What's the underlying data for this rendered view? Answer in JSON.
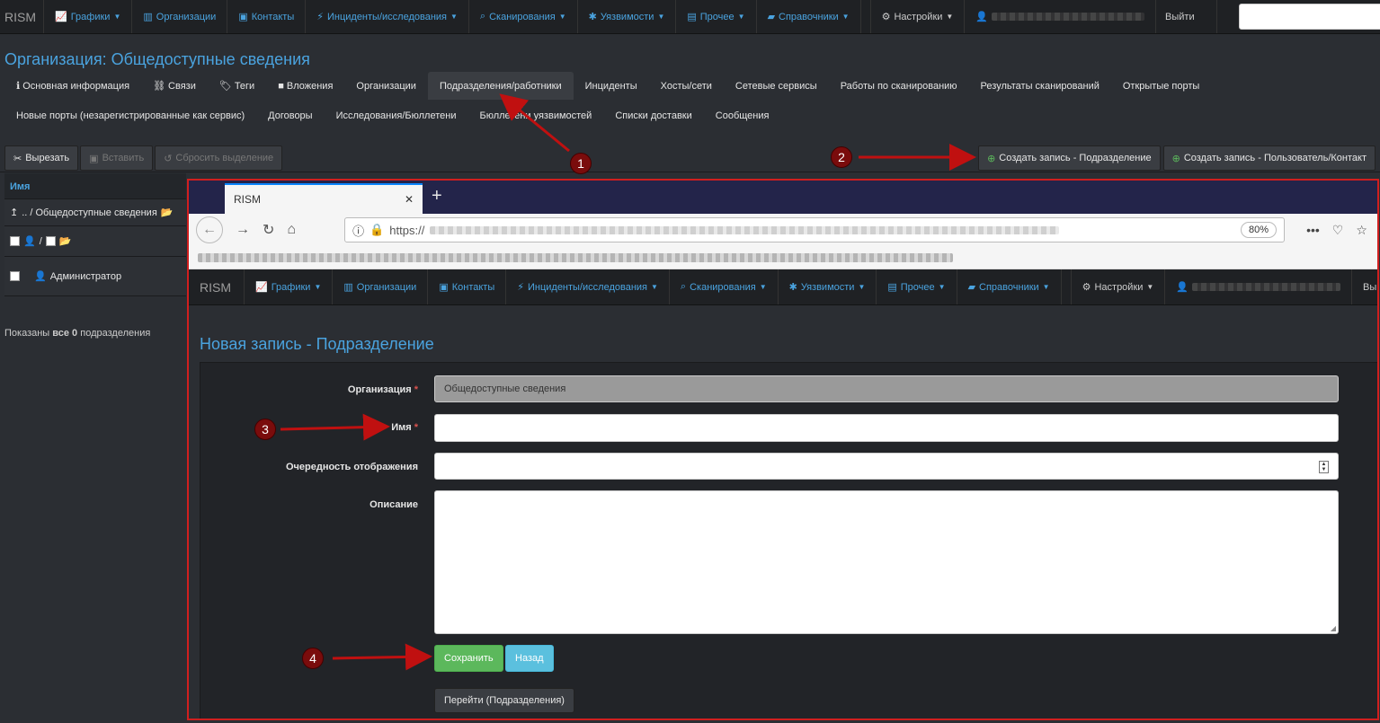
{
  "navbar": {
    "brand": "RISM",
    "items": [
      {
        "icon": "chart-icon",
        "label": "Графики"
      },
      {
        "icon": "bar-chart-icon",
        "label": "Организации"
      },
      {
        "icon": "id-card-icon",
        "label": "Контакты"
      },
      {
        "icon": "bolt-icon",
        "label": "Инциденты/исследования"
      },
      {
        "icon": "search-icon",
        "label": "Сканирования"
      },
      {
        "icon": "bug-icon",
        "label": "Уязвимости"
      },
      {
        "icon": "box-icon",
        "label": "Прочее"
      },
      {
        "icon": "book-icon",
        "label": "Справочники"
      }
    ],
    "settings": "Настройки",
    "logout": "Выйти"
  },
  "page": {
    "title": "Организация: Общедоступные сведения"
  },
  "tabs_row1": [
    "Основная информация",
    "Связи",
    "Теги",
    "Вложения",
    "Организации",
    "Подразделения/работники",
    "Инциденты",
    "Хосты/сети",
    "Сетевые сервисы",
    "Работы по сканированию",
    "Результаты сканирований",
    "Открытые порты"
  ],
  "tabs_row2": [
    "Новые порты (незарегистрированные как сервис)",
    "Договоры",
    "Исследования/Бюллетени",
    "Бюллетени уязвимостей",
    "Списки доставки",
    "Сообщения"
  ],
  "toolbar": {
    "cut": "Вырезать",
    "paste": "Вставить",
    "reset": "Сбросить выделение",
    "create_department": "Создать запись - Подразделение",
    "create_user": "Создать запись - Пользователь/Контакт"
  },
  "tree": {
    "header": "Имя",
    "root": ".. / Общедоступные сведения",
    "slash": "/",
    "admin": "Администратор",
    "footer_prefix": "Показаны ",
    "footer_bold": "все 0",
    "footer_suffix": " подразделения"
  },
  "browser": {
    "tab_title": "RISM",
    "url_prefix": "https://",
    "zoom": "80%"
  },
  "form": {
    "title": "Новая запись - Подразделение",
    "org_label": "Организация",
    "org_value": "Общедоступные сведения",
    "name_label": "Имя",
    "order_label": "Очередность отображения",
    "desc_label": "Описание",
    "save": "Сохранить",
    "back": "Назад",
    "goto": "Перейти (Подразделения)"
  },
  "annotations": [
    "1",
    "2",
    "3",
    "4"
  ]
}
